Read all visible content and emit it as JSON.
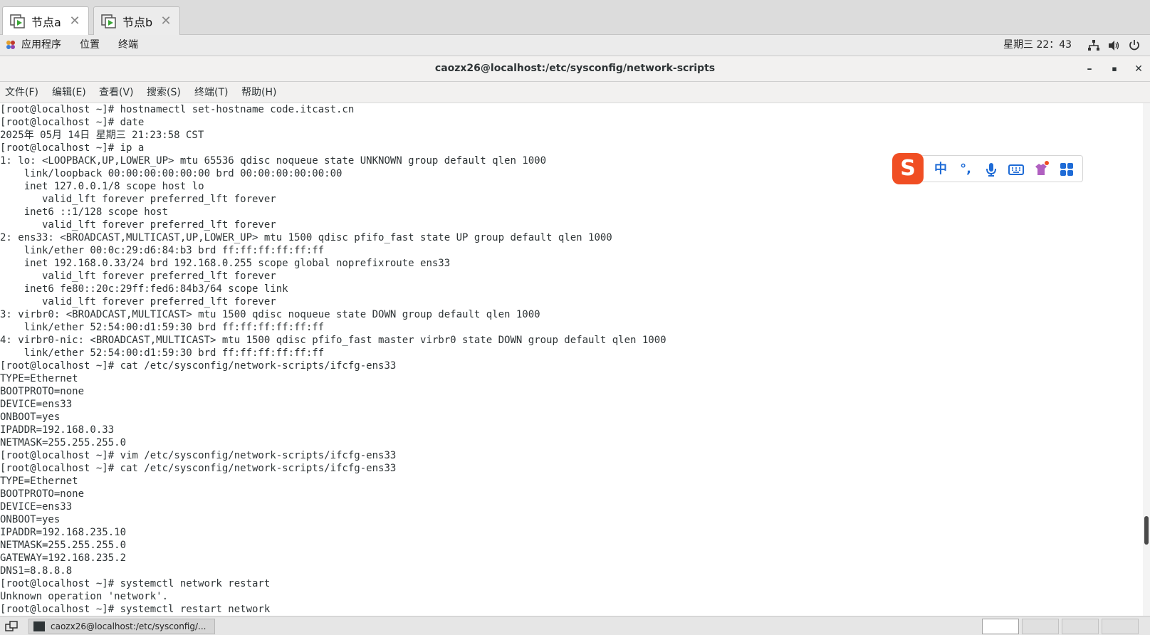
{
  "vm_tabs": [
    {
      "label": "节点a",
      "active": true
    },
    {
      "label": "节点b",
      "active": false
    }
  ],
  "gnome_bar": {
    "menus": [
      "应用程序",
      "位置",
      "终端"
    ],
    "clock": "星期三 22：43",
    "tray_icons": [
      "network-icon",
      "volume-icon",
      "power-icon"
    ]
  },
  "window": {
    "title": "caozx26@localhost:/etc/sysconfig/network-scripts",
    "buttons": [
      "minimize",
      "maximize",
      "close"
    ]
  },
  "menubar": [
    "文件(F)",
    "编辑(E)",
    "查看(V)",
    "搜索(S)",
    "终端(T)",
    "帮助(H)"
  ],
  "terminal": {
    "lines": [
      "[root@localhost ~]# hostnamectl set-hostname code.itcast.cn",
      "[root@localhost ~]# date",
      "2025年 05月 14日 星期三 21:23:58 CST",
      "[root@localhost ~]# ip a",
      "1: lo: <LOOPBACK,UP,LOWER_UP> mtu 65536 qdisc noqueue state UNKNOWN group default qlen 1000",
      "    link/loopback 00:00:00:00:00:00 brd 00:00:00:00:00:00",
      "    inet 127.0.0.1/8 scope host lo",
      "       valid_lft forever preferred_lft forever",
      "    inet6 ::1/128 scope host",
      "       valid_lft forever preferred_lft forever",
      "2: ens33: <BROADCAST,MULTICAST,UP,LOWER_UP> mtu 1500 qdisc pfifo_fast state UP group default qlen 1000",
      "    link/ether 00:0c:29:d6:84:b3 brd ff:ff:ff:ff:ff:ff",
      "    inet 192.168.0.33/24 brd 192.168.0.255 scope global noprefixroute ens33",
      "       valid_lft forever preferred_lft forever",
      "    inet6 fe80::20c:29ff:fed6:84b3/64 scope link",
      "       valid_lft forever preferred_lft forever",
      "3: virbr0: <BROADCAST,MULTICAST> mtu 1500 qdisc noqueue state DOWN group default qlen 1000",
      "    link/ether 52:54:00:d1:59:30 brd ff:ff:ff:ff:ff:ff",
      "4: virbr0-nic: <BROADCAST,MULTICAST> mtu 1500 qdisc pfifo_fast master virbr0 state DOWN group default qlen 1000",
      "    link/ether 52:54:00:d1:59:30 brd ff:ff:ff:ff:ff:ff",
      "[root@localhost ~]# cat /etc/sysconfig/network-scripts/ifcfg-ens33",
      "TYPE=Ethernet",
      "BOOTPROTO=none",
      "DEVICE=ens33",
      "ONBOOT=yes",
      "IPADDR=192.168.0.33",
      "NETMASK=255.255.255.0",
      "[root@localhost ~]# vim /etc/sysconfig/network-scripts/ifcfg-ens33",
      "[root@localhost ~]# cat /etc/sysconfig/network-scripts/ifcfg-ens33",
      "TYPE=Ethernet",
      "BOOTPROTO=none",
      "DEVICE=ens33",
      "ONBOOT=yes",
      "IPADDR=192.168.235.10",
      "NETMASK=255.255.255.0",
      "GATEWAY=192.168.235.2",
      "DNS1=8.8.8.8",
      "[root@localhost ~]# systemctl network restart",
      "Unknown operation 'network'.",
      "[root@localhost ~]# systemctl restart network"
    ]
  },
  "ime_toolbar": {
    "logo": "S",
    "items": [
      {
        "name": "ime-mode-chinese",
        "label": "中"
      },
      {
        "name": "ime-punctuation",
        "label": "°,"
      },
      {
        "name": "mic-icon",
        "label": ""
      },
      {
        "name": "keyboard-icon",
        "label": ""
      },
      {
        "name": "skin-icon",
        "label": ""
      },
      {
        "name": "apps-grid-icon",
        "label": ""
      }
    ]
  },
  "taskbar": {
    "item_label": "caozx26@localhost:/etc/sysconfig/...",
    "workspaces": 4,
    "current_workspace": 1
  },
  "colors": {
    "accent_blue": "#1e6bd6",
    "ime_logo": "#f04e23",
    "terminal_fg": "#2e3436",
    "vm_play_green": "#3aa636"
  }
}
